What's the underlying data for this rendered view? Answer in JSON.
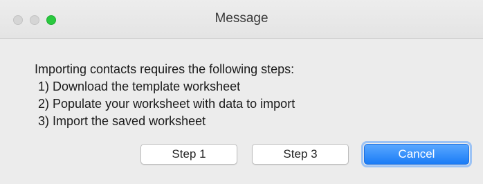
{
  "window": {
    "title": "Message",
    "controls": {
      "close": {
        "color": "#d5d5d5"
      },
      "minimize": {
        "color": "#d5d5d5"
      },
      "zoom": {
        "color": "#2ac93f"
      }
    }
  },
  "message": {
    "lines": [
      "Importing contacts requires the following steps:",
      " 1) Download the template worksheet",
      " 2) Populate your worksheet with data to import",
      " 3) Import the saved worksheet"
    ]
  },
  "buttons": {
    "step1": "Step 1",
    "step3": "Step 3",
    "cancel": "Cancel"
  },
  "colors": {
    "accent": "#1a7cf6",
    "background": "#ececec"
  }
}
